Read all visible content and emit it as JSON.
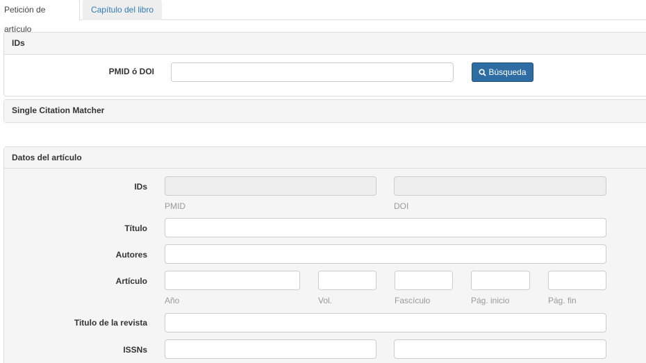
{
  "tabs": {
    "article": "Petición de artículo",
    "chapter": "Capítulo del libro"
  },
  "ids_panel": {
    "heading": "IDs",
    "pmid_doi_label": "PMID ó DOI",
    "pmid_doi_value": "",
    "search_button": "Búsqueda"
  },
  "citation_matcher": {
    "heading": "Single Citation Matcher"
  },
  "article_data": {
    "heading": "Datos del artículo",
    "ids_label": "IDs",
    "pmid_help": "PMID",
    "doi_help": "DOI",
    "title_label": "Título",
    "authors_label": "Autores",
    "article_label": "Artículo",
    "year_help": "Año",
    "vol_help": "Vol.",
    "issue_help": "Fascículo",
    "page_start_help": "Pág. inicio",
    "page_end_help": "Pág. fin",
    "journal_label": "Titulo de la revista",
    "issns_label": "ISSNs"
  },
  "colors": {
    "primary": "#337ab7",
    "button_bg": "#2e6da4",
    "panel_heading_bg": "#f5f5f5",
    "border": "#dddddd"
  }
}
